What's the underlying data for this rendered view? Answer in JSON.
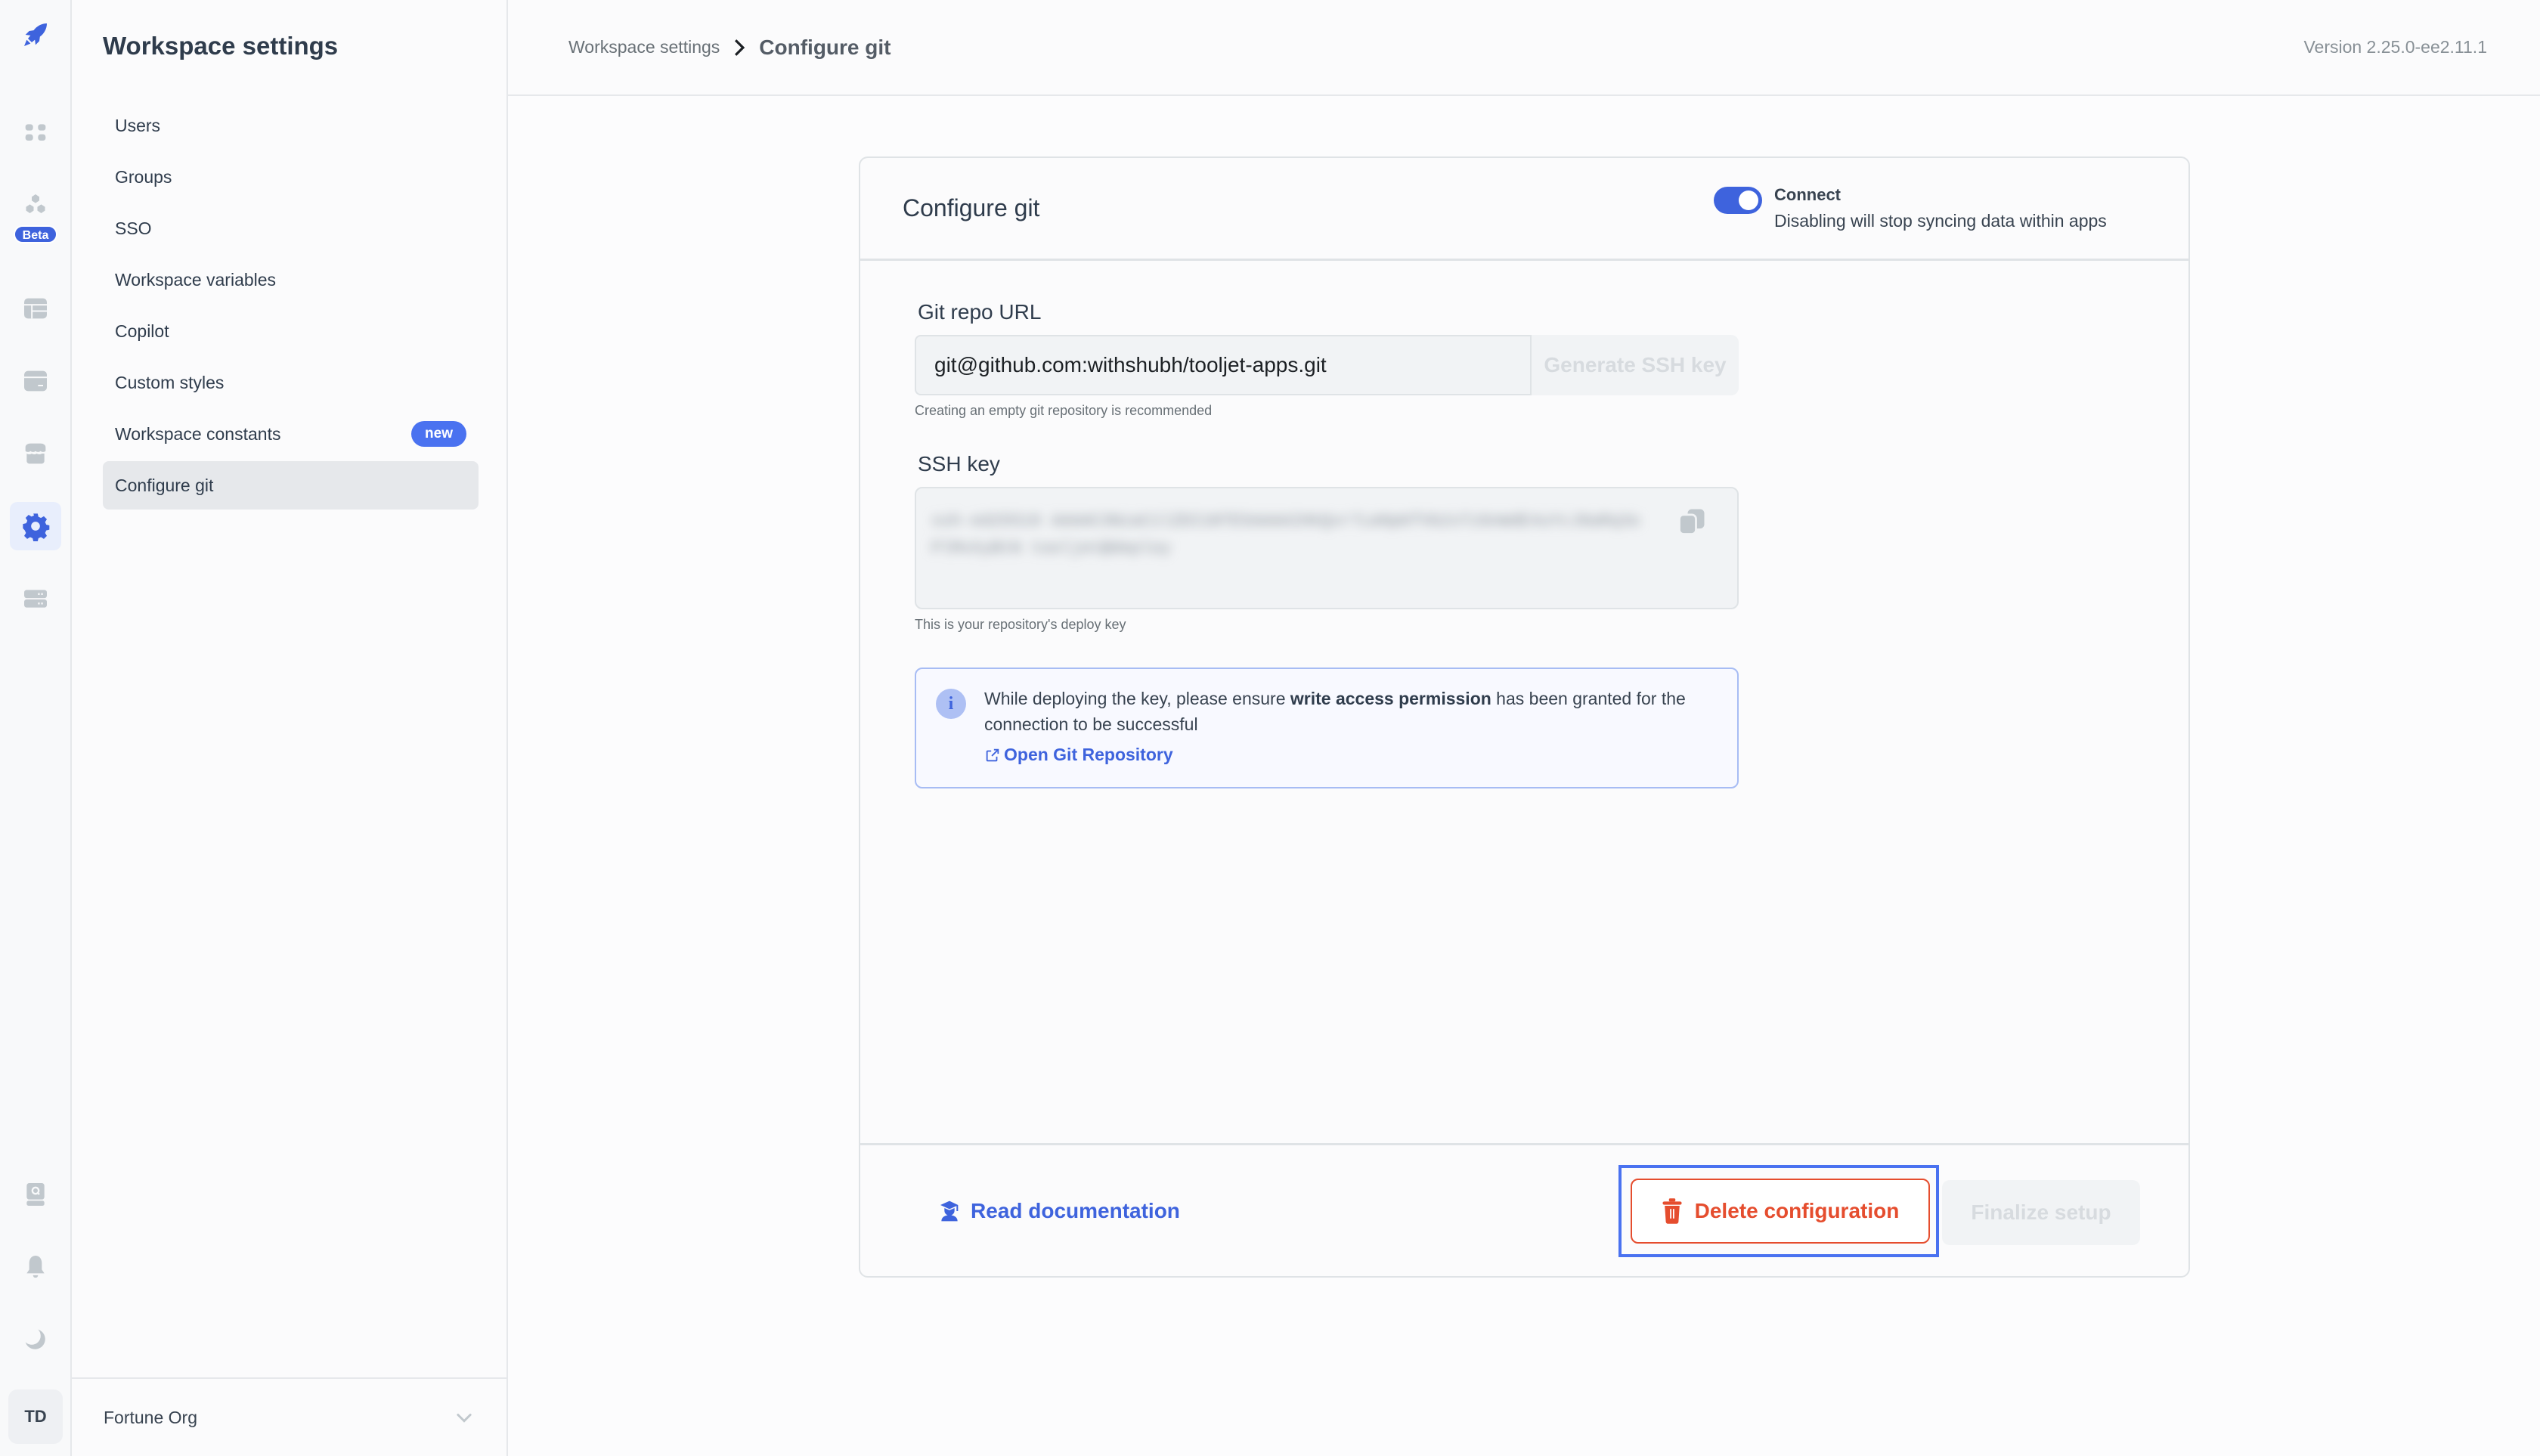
{
  "rail": {
    "items": [
      {
        "name": "apps",
        "icon": "grid-icon"
      },
      {
        "name": "workflows",
        "icon": "hexagons-icon",
        "badge": "Beta"
      },
      {
        "name": "database",
        "icon": "table-icon"
      },
      {
        "name": "data-sources",
        "icon": "datasource-icon"
      },
      {
        "name": "marketplace",
        "icon": "store-icon"
      },
      {
        "name": "workspace-settings",
        "icon": "gear-icon",
        "active": true
      },
      {
        "name": "instance-settings",
        "icon": "server-icon"
      }
    ],
    "bottom": [
      {
        "name": "docs",
        "icon": "book-search-icon"
      },
      {
        "name": "notifications",
        "icon": "bell-icon"
      },
      {
        "name": "theme",
        "icon": "moon-icon"
      }
    ],
    "avatar_initials": "TD",
    "accent": "#3e63dd"
  },
  "sidebar": {
    "title": "Workspace settings",
    "items": [
      {
        "label": "Users"
      },
      {
        "label": "Groups"
      },
      {
        "label": "SSO"
      },
      {
        "label": "Workspace variables"
      },
      {
        "label": "Copilot"
      },
      {
        "label": "Custom styles"
      },
      {
        "label": "Workspace constants",
        "badge": "new"
      },
      {
        "label": "Configure git",
        "active": true
      }
    ],
    "org_name": "Fortune Org"
  },
  "header": {
    "breadcrumb_parent": "Workspace settings",
    "breadcrumb_current": "Configure git",
    "version": "Version 2.25.0-ee2.11.1"
  },
  "card": {
    "title": "Configure git",
    "connect_label": "Connect",
    "connect_enabled": true,
    "connect_description": "Disabling will stop syncing data within apps",
    "repo_label": "Git repo URL",
    "repo_value": "git@github.com:withshubh/tooljet-apps.git",
    "generate_button": "Generate SSH key",
    "repo_hint": "Creating an empty git repository is recommended",
    "ssh_label": "SSH key",
    "ssh_value_blurred": "ssh-ed25519 AAAAC3NzaC1lZDI1NTE5AAAAIHkQxr7Lm9pKfVb2sTzGnWdE4uYcJ8aRq3oPlMvXyBtN tooljet@deploy",
    "ssh_hint": "This is your repository's deploy key",
    "info_text_before": "While deploying the key, please ensure ",
    "info_text_bold": "write access permission",
    "info_text_after": " has been granted for the connection to be successful",
    "info_link": "Open Git Repository",
    "read_docs": "Read documentation",
    "delete_button": "Delete configuration",
    "finalize_button": "Finalize setup"
  },
  "colors": {
    "primary": "#3e63dd",
    "danger": "#e54d2e",
    "focus": "#4a72f0"
  }
}
